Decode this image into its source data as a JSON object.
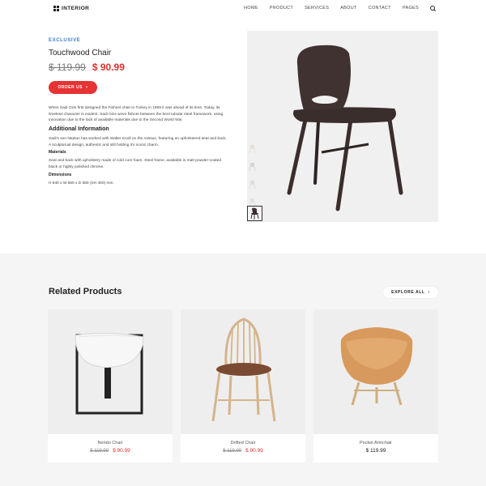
{
  "header": {
    "logo_text": "INTERIOR",
    "nav": [
      "HOME",
      "PRODUCT",
      "SERVICES",
      "ABOUT",
      "CONTACT",
      "PAGES"
    ]
  },
  "product": {
    "eyebrow": "EXCLUSIVE",
    "title": "Touchwood Chair",
    "old_price": "$ 119.99",
    "new_price": "$ 90.99",
    "order_label": "ORDER US",
    "description": "When Sadi Ozis first designed the Fishnet chair in Turkey in 1959 it was ahead of its time. Today, its timeless character is evident. Sadi Ozis wove fishnet between the bent tubular steel framework, using innovation due to the lack of available materials due to the Second World War.",
    "additional_heading": "Additional Information",
    "additional_text": "Sadi's son Neptun has worked with Walter Knoll on the reissue, featuring an upholstered seat and back. A sculpturual design, authentic and still holding it's iconic charm.",
    "materials_heading": "Materials",
    "materials_text": "Seat and back with upholstery made of cold cure foam. Steel frame, available in matt powder-coated black or highly polished chrome.",
    "dimensions_heading": "Dimensions",
    "dimensions_text": "H 840 x W 660 x D 680 (SH 450) mm."
  },
  "related": {
    "title": "Related Products",
    "explore_label": "EXPLORE ALL",
    "items": [
      {
        "name": "Nendo Chair",
        "old_price": "$ 119.99",
        "new_price": "$ 90.99"
      },
      {
        "name": "Drifted Chair",
        "old_price": "$ 119.99",
        "new_price": "$ 90.99"
      },
      {
        "name": "Pocket Armchair",
        "price": "$ 119.99"
      }
    ]
  },
  "colors": {
    "accent_red": "#e63333",
    "accent_blue": "#3b7bd5",
    "chair_dark": "#3a2e2c",
    "leather": "#d89a5c",
    "wood": "#d4b48a"
  }
}
